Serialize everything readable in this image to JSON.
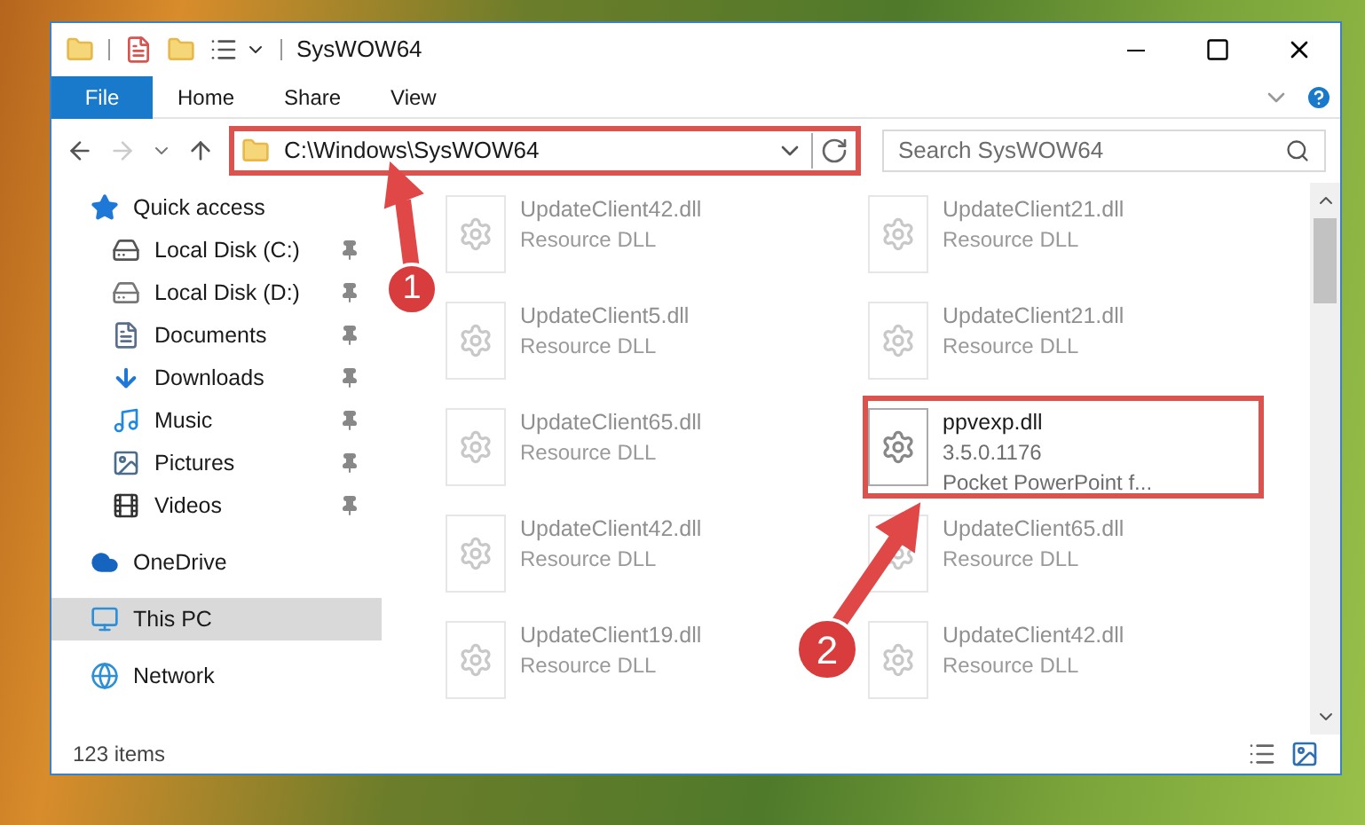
{
  "window": {
    "title": "SysWOW64"
  },
  "ribbon_tabs": [
    {
      "label": "File",
      "selected": true
    },
    {
      "label": "Home",
      "selected": false
    },
    {
      "label": "Share",
      "selected": false
    },
    {
      "label": "View",
      "selected": false
    }
  ],
  "address": {
    "path": "C:\\Windows\\SysWOW64",
    "highlighted": true
  },
  "search": {
    "placeholder": "Search SysWOW64"
  },
  "sidebar": {
    "items": [
      {
        "label": "Quick access",
        "kind": "star",
        "selected": false,
        "children": [
          {
            "label": "Local Disk (C:)",
            "kind": "systemdrive",
            "pinned": true,
            "selected": false
          },
          {
            "label": "Local Disk (D:)",
            "kind": "drive",
            "pinned": true,
            "selected": false
          },
          {
            "label": "Documents",
            "kind": "documents",
            "pinned": true,
            "selected": false
          },
          {
            "label": "Downloads",
            "kind": "downloads",
            "pinned": true,
            "selected": false
          },
          {
            "label": "Music",
            "kind": "music",
            "pinned": true,
            "selected": false
          },
          {
            "label": "Pictures",
            "kind": "pictures",
            "pinned": true,
            "selected": false
          },
          {
            "label": "Videos",
            "kind": "videos",
            "pinned": true,
            "selected": false
          }
        ]
      },
      {
        "label": "OneDrive",
        "kind": "cloud",
        "selected": false
      },
      {
        "label": "This PC",
        "kind": "pc",
        "selected": true
      },
      {
        "label": "Network",
        "kind": "network",
        "selected": false
      }
    ]
  },
  "files": [
    {
      "name": "UpdateClient42.dll",
      "details": [
        "Resource DLL"
      ],
      "dimmed": true,
      "highlighted": false
    },
    {
      "name": "UpdateClient21.dll",
      "details": [
        "Resource DLL"
      ],
      "dimmed": true,
      "highlighted": false
    },
    {
      "name": "UpdateClient5.dll",
      "details": [
        "Resource DLL"
      ],
      "dimmed": true,
      "highlighted": false
    },
    {
      "name": "UpdateClient21.dll",
      "details": [
        "Resource DLL"
      ],
      "dimmed": true,
      "highlighted": false
    },
    {
      "name": "UpdateClient65.dll",
      "details": [
        "Resource DLL"
      ],
      "dimmed": true,
      "highlighted": false
    },
    {
      "name": "ppvexp.dll",
      "details": [
        "3.5.0.1176",
        "Pocket PowerPoint f..."
      ],
      "dimmed": false,
      "highlighted": true
    },
    {
      "name": "UpdateClient42.dll",
      "details": [
        "Resource DLL"
      ],
      "dimmed": true,
      "highlighted": false
    },
    {
      "name": "UpdateClient65.dll",
      "details": [
        "Resource DLL"
      ],
      "dimmed": true,
      "highlighted": false
    },
    {
      "name": "UpdateClient19.dll",
      "details": [
        "Resource DLL"
      ],
      "dimmed": true,
      "highlighted": false
    },
    {
      "name": "UpdateClient42.dll",
      "details": [
        "Resource DLL"
      ],
      "dimmed": true,
      "highlighted": false
    }
  ],
  "status_bar": {
    "item_count": "123 items"
  },
  "annotations": [
    {
      "label": "1"
    },
    {
      "label": "2"
    }
  ]
}
